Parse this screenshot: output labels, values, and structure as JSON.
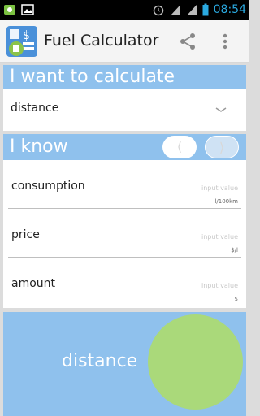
{
  "status_bar": {
    "time": "08:54",
    "icons": [
      "app-notification-icon",
      "image-notification-icon",
      "alarm-icon",
      "signal-icon",
      "signal-icon",
      "battery-icon"
    ]
  },
  "app_bar": {
    "title": "Fuel Calculator",
    "icons": [
      "app-logo-icon",
      "share-icon",
      "overflow-menu-icon"
    ]
  },
  "calculate_card": {
    "heading": "I want to calculate",
    "selected": "distance"
  },
  "know_card": {
    "heading": "I know",
    "prev_glyph": "⟨",
    "next_glyph": "⟩",
    "fields": [
      {
        "label": "consumption",
        "placeholder": "input value",
        "unit": "l/100km"
      },
      {
        "label": "price",
        "placeholder": "input value",
        "unit": "$/l"
      },
      {
        "label": "amount",
        "placeholder": "input value",
        "unit": "$"
      }
    ]
  },
  "result_card": {
    "label": "distance"
  },
  "colors": {
    "accent_blue": "#8fc1ed",
    "result_green": "#aad97a",
    "time_blue": "#2aa9e0"
  }
}
